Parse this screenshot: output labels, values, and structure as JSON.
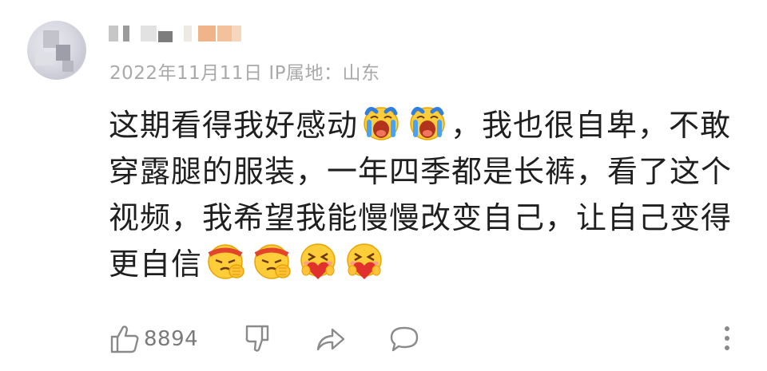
{
  "comment": {
    "meta": "2022年11月11日  IP属地：山东",
    "line1_before": "这期看得我好感动",
    "line1_after": "，我也很自卑，不敢",
    "line2": "穿露腿的服装，一年四季都是长裤，看了这个",
    "line3": "视频，我希望我能慢慢改变自己，让自己变得",
    "line4": "更自信",
    "emojis_line1": [
      "crying-emoji",
      "crying-emoji"
    ],
    "emojis_line4": [
      "determined-fist-emoji",
      "determined-fist-emoji",
      "heart-hug-emoji",
      "heart-hug-emoji"
    ]
  },
  "actions": {
    "like_count": "8894",
    "icons": [
      "thumbs-up-icon",
      "thumbs-down-icon",
      "share-icon",
      "comment-icon",
      "more-icon"
    ]
  },
  "colors": {
    "text": "#1f1f1f",
    "meta": "#a9a9a9",
    "icon": "#8a8a8a"
  }
}
